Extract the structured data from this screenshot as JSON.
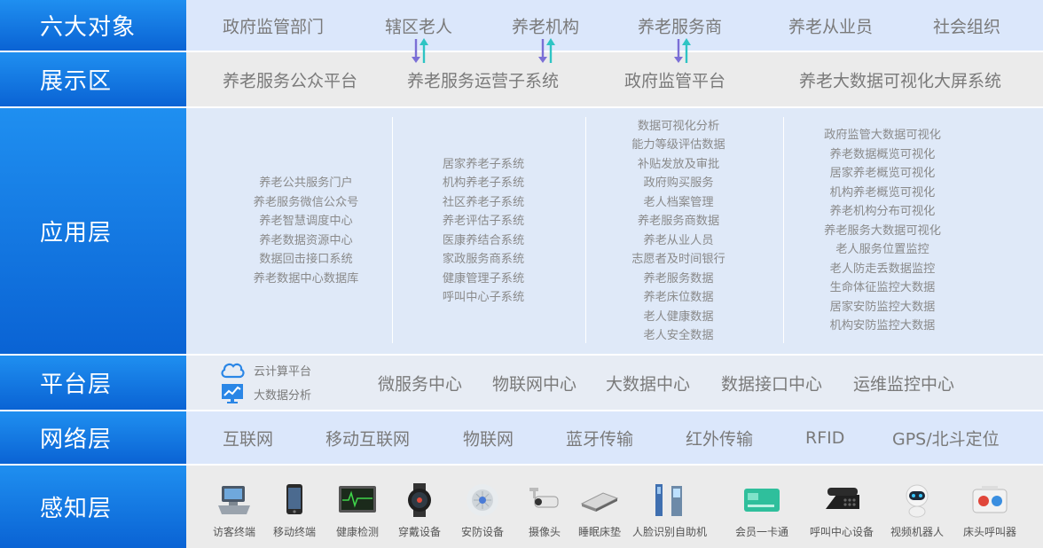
{
  "rows": {
    "objects": {
      "label": "六大对象",
      "items": [
        "政府监管部门",
        "辖区老人",
        "养老机构",
        "养老服务商",
        "养老从业员",
        "社会组织"
      ]
    },
    "display": {
      "label": "展示区",
      "items": [
        "养老服务公众平台",
        "养老服务运营子系统",
        "政府监管平台",
        "养老大数据可视化大屏系统"
      ]
    },
    "application": {
      "label": "应用层",
      "columns": [
        [
          "养老公共服务门户",
          "养老服务微信公众号",
          "养老智慧调度中心",
          "养老数据资源中心",
          "数据回击接口系统",
          "养老数据中心数据库"
        ],
        [
          "居家养老子系统",
          "机构养老子系统",
          "社区养老子系统",
          "养老评估子系统",
          "医康养结合系统",
          "家政服务商系统",
          "健康管理子系统",
          "呼叫中心子系统"
        ],
        [
          "数据可视化分析",
          "能力等级评估数据",
          "补贴发放及审批",
          "政府购买服务",
          "老人档案管理",
          "养老服务商数据",
          "养老从业人员",
          "志愿者及时间银行",
          "养老服务数据",
          "养老床位数据",
          "老人健康数据",
          "老人安全数据"
        ],
        [
          "政府监管大数据可视化",
          "养老数据概览可视化",
          "居家养老概览可视化",
          "机构养老概览可视化",
          "养老机构分布可视化",
          "养老服务大数据可视化",
          "老人服务位置监控",
          "老人防走丢数据监控",
          "生命体征监控大数据",
          "居家安防监控大数据",
          "机构安防监控大数据"
        ]
      ]
    },
    "platform": {
      "label": "平台层",
      "cloud": "云计算平台",
      "bigdata": "大数据分析",
      "items": [
        "微服务中心",
        "物联网中心",
        "大数据中心",
        "数据接口中心",
        "运维监控中心"
      ]
    },
    "network": {
      "label": "网络层",
      "items": [
        "互联网",
        "移动互联网",
        "物联网",
        "蓝牙传输",
        "红外传输",
        "RFID",
        "GPS/北斗定位"
      ]
    },
    "perception": {
      "label": "感知层",
      "devices": [
        {
          "name": "访客终端",
          "icon": "kiosk-terminal-icon"
        },
        {
          "name": "移动终端",
          "icon": "smartphone-icon"
        },
        {
          "name": "健康检测",
          "icon": "health-monitor-icon"
        },
        {
          "name": "穿戴设备",
          "icon": "smartwatch-icon"
        },
        {
          "name": "安防设备",
          "icon": "smoke-detector-icon"
        },
        {
          "name": "摄像头",
          "icon": "camera-icon"
        },
        {
          "name": "睡眠床垫",
          "icon": "sleep-pad-icon"
        },
        {
          "name": "人脸识别自助机",
          "icon": "face-recognition-kiosk-icon"
        },
        {
          "name": "会员一卡通",
          "icon": "member-card-icon"
        },
        {
          "name": "呼叫中心设备",
          "icon": "telephone-icon"
        },
        {
          "name": "视频机器人",
          "icon": "robot-icon"
        },
        {
          "name": "床头呼叫器",
          "icon": "bedside-caller-icon"
        }
      ]
    }
  },
  "colors": {
    "label_top": "#1f8ff0",
    "label_bottom": "#0a63d4",
    "arrow_down": "#7b6fd6",
    "arrow_up": "#2ec4c4"
  }
}
